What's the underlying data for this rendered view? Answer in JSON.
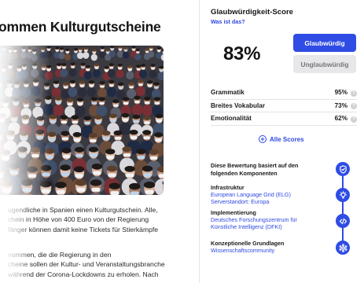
{
  "article": {
    "headline": "ommen Kulturgutscheine",
    "photo_alt": "Menschenmenge mit Masken",
    "paragraph_1": [
      "ugendliche in Spanien einen Kulturgutschein. Alle,",
      "chein in Höhe von 400 Euro von der Regierung",
      "fänger können damit keine Tickets für Stierkämpfe"
    ],
    "paragraph_2": [
      "nommen, die die Regierung in den",
      "cheine sollen der Kultur- und Veranstaltungsbranche",
      "während der Corona-Lockdowns zu erholen. Nach"
    ]
  },
  "panel": {
    "title": "Glaubwürdigkeit-Score",
    "link": "Was ist das?",
    "score": "83%",
    "btn_credible": "Glaubwürdig",
    "btn_not_credible": "Unglaubwürdig",
    "metrics": [
      {
        "label": "Grammatik",
        "value": "95%"
      },
      {
        "label": "Breites Vokabular",
        "value": "73%"
      },
      {
        "label": "Emotionalität",
        "value": "62%"
      }
    ],
    "help_glyph": "?",
    "all_scores": "Alle Scores",
    "components_intro": "Diese Bewertung basiert auf den folgenden Komponenten",
    "components": [
      {
        "title": "Infrastruktur",
        "lines": [
          "European Language Grid (ELG)",
          "Serverstandort: Europa"
        ]
      },
      {
        "title": "Implementierung",
        "lines": [
          "Deutsches Forschungszentrum für",
          "Künstliche Intelligenz (DFKI)"
        ]
      },
      {
        "title": "Konzeptionelle Grundlagen",
        "lines": [
          "Wissenschaftscommunity"
        ]
      }
    ],
    "icons": [
      "shield-check-icon",
      "lightbulb-icon",
      "code-icon",
      "network-icon"
    ]
  },
  "colors": {
    "accent": "#2f4ce4",
    "button_secondary_bg": "#e7e7ea",
    "link": "#2f49e0"
  }
}
